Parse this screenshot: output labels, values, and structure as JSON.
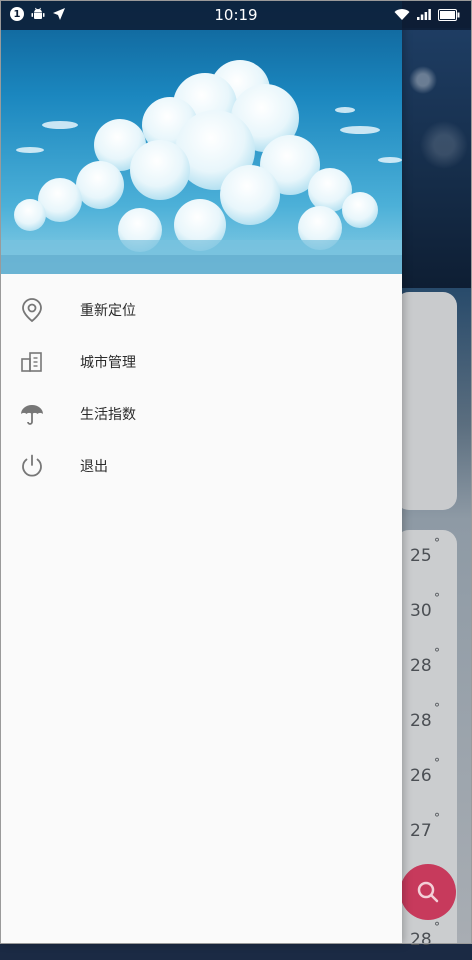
{
  "status_bar": {
    "notification_count": "1",
    "time": "10:19",
    "icons": [
      "notification-badge",
      "android-icon",
      "location-arrow-icon",
      "wifi-icon",
      "signal-icon",
      "battery-icon"
    ]
  },
  "drawer": {
    "header_image": "sky-clouds-illustration",
    "menu": [
      {
        "label": "重新定位",
        "icon": "location-pin-icon"
      },
      {
        "label": "城市管理",
        "icon": "city-building-icon"
      },
      {
        "label": "生活指数",
        "icon": "umbrella-icon"
      },
      {
        "label": "退出",
        "icon": "power-icon"
      }
    ]
  },
  "background": {
    "temperatures": [
      "25",
      "30",
      "28",
      "28",
      "26",
      "27",
      "28"
    ],
    "degree_symbol": "°",
    "fab_icon": "search-icon",
    "fab_color": "#c73a5c"
  }
}
